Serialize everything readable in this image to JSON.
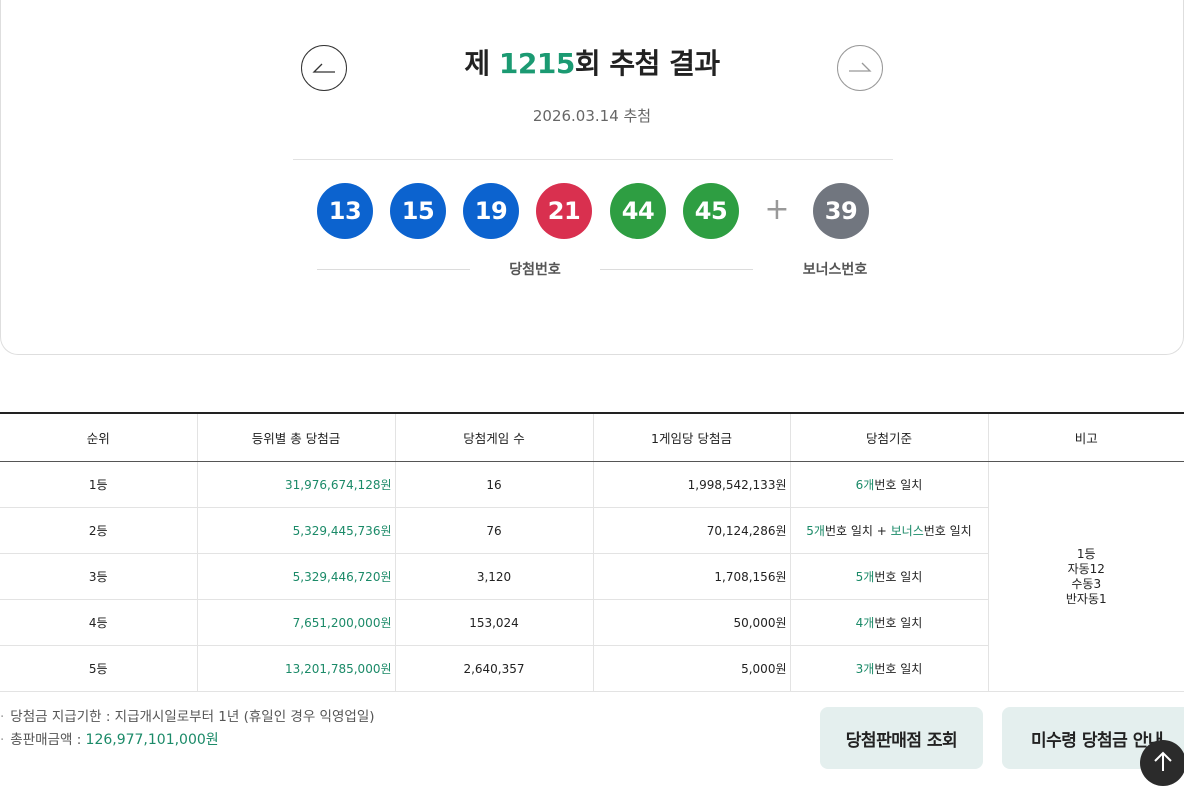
{
  "draw": {
    "prefix": "제 ",
    "round": "1215",
    "suffix": "회 추첨 결과",
    "date": "2026.03.14 추첨",
    "prev_icon": "arrow-left-icon",
    "next_icon": "arrow-right-icon"
  },
  "balls": {
    "winning": [
      {
        "number": "13",
        "color": "#0c63cf"
      },
      {
        "number": "15",
        "color": "#0c63cf"
      },
      {
        "number": "19",
        "color": "#0c63cf"
      },
      {
        "number": "21",
        "color": "#d9304f"
      },
      {
        "number": "44",
        "color": "#2e9e42"
      },
      {
        "number": "45",
        "color": "#2e9e42"
      }
    ],
    "plus": "+",
    "bonus": {
      "number": "39",
      "color": "#71767f"
    },
    "winning_label": "당첨번호",
    "bonus_label": "보너스번호"
  },
  "table": {
    "headers": [
      "순위",
      "등위별 총 당첨금",
      "당첨게임 수",
      "1게임당 당첨금",
      "당첨기준",
      "비고"
    ],
    "rows": [
      {
        "rank": "1등",
        "total": "31,976,674,128원",
        "count": "16",
        "per_game": "1,998,542,133원",
        "crit_num": "6개",
        "crit_text": "번호 일치",
        "crit_extra_pre": "",
        "crit_extra_bonus": "",
        "crit_extra_post": ""
      },
      {
        "rank": "2등",
        "total": "5,329,445,736원",
        "count": "76",
        "per_game": "70,124,286원",
        "crit_num": "5개",
        "crit_text": "번호 일치",
        "crit_extra_pre": " + ",
        "crit_extra_bonus": "보너스",
        "crit_extra_post": "번호 일치"
      },
      {
        "rank": "3등",
        "total": "5,329,446,720원",
        "count": "3,120",
        "per_game": "1,708,156원",
        "crit_num": "5개",
        "crit_text": "번호 일치",
        "crit_extra_pre": "",
        "crit_extra_bonus": "",
        "crit_extra_post": ""
      },
      {
        "rank": "4등",
        "total": "7,651,200,000원",
        "count": "153,024",
        "per_game": "50,000원",
        "crit_num": "4개",
        "crit_text": "번호 일치",
        "crit_extra_pre": "",
        "crit_extra_bonus": "",
        "crit_extra_post": ""
      },
      {
        "rank": "5등",
        "total": "13,201,785,000원",
        "count": "2,640,357",
        "per_game": "5,000원",
        "crit_num": "3개",
        "crit_text": "번호 일치",
        "crit_extra_pre": "",
        "crit_extra_bonus": "",
        "crit_extra_post": ""
      }
    ],
    "remark": [
      "1등",
      "자동12",
      "수동3",
      "반자동1"
    ]
  },
  "notes": {
    "bullet": "·",
    "deadline": "당첨금 지급기한 : 지급개시일로부터 1년 (휴일인 경우 익영업일)",
    "sales_label": "총판매금액 : ",
    "sales_value": "126,977,101,000원"
  },
  "buttons": {
    "store_lookup": "당첨판매점 조회",
    "unclaimed": "미수령 당첨금 안내",
    "top_icon": "arrow-up-icon"
  }
}
